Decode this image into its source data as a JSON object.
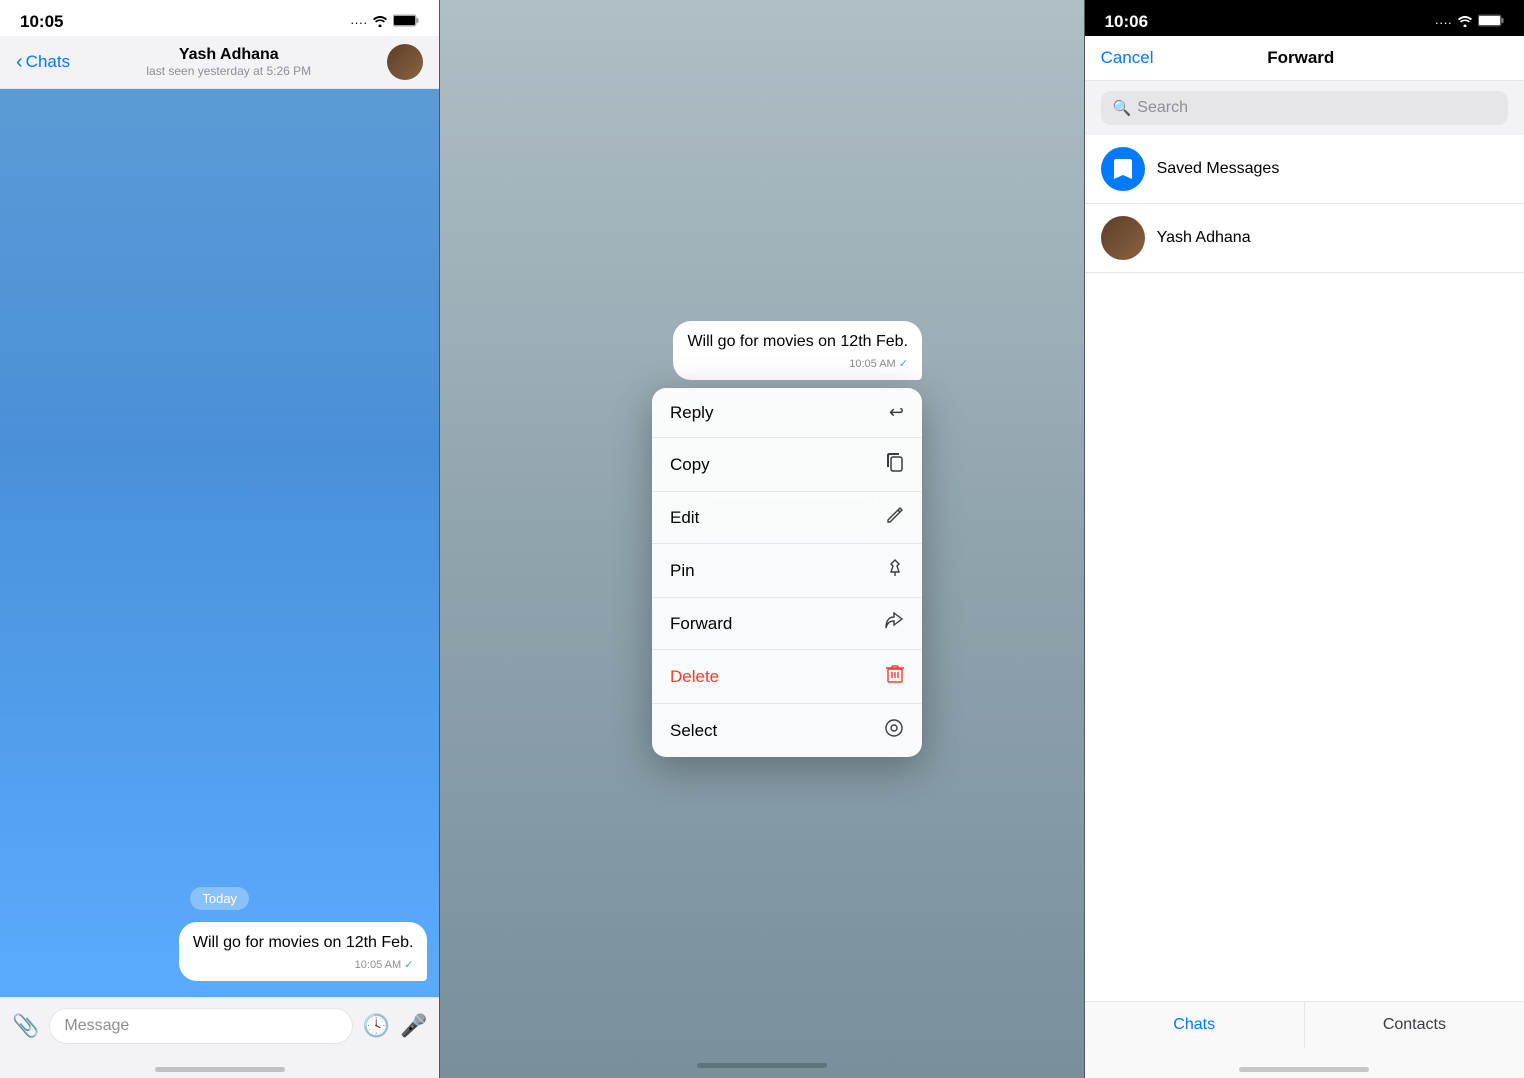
{
  "panel1": {
    "status_bar": {
      "time": "10:05",
      "signal": "···· ",
      "wifi": "WiFi",
      "battery": "🔋"
    },
    "header": {
      "back_label": "Chats",
      "contact_name": "Yash Adhana",
      "contact_status": "last seen yesterday at 5:26 PM"
    },
    "date_badge": "Today",
    "message": {
      "text": "Will go for movies on 12th Feb.",
      "time": "10:05 AM",
      "check": "✓"
    },
    "input": {
      "placeholder": "Message"
    }
  },
  "panel2": {
    "message": {
      "text": "Will go for movies on 12th Feb.",
      "time": "10:05 AM",
      "check": "✓"
    },
    "menu_items": [
      {
        "label": "Reply",
        "icon": "↩",
        "is_delete": false
      },
      {
        "label": "Copy",
        "icon": "⧉",
        "is_delete": false
      },
      {
        "label": "Edit",
        "icon": "✎",
        "is_delete": false
      },
      {
        "label": "Pin",
        "icon": "⚲",
        "is_delete": false
      },
      {
        "label": "Forward",
        "icon": "↪",
        "is_delete": false
      },
      {
        "label": "Delete",
        "icon": "🗑",
        "is_delete": true
      },
      {
        "label": "Select",
        "icon": "⊙",
        "is_delete": false
      }
    ]
  },
  "panel3": {
    "status_bar": {
      "time": "10:06",
      "signal": "···· ",
      "wifi": "WiFi",
      "battery": "🔋"
    },
    "header": {
      "cancel_label": "Cancel",
      "title": "Forward"
    },
    "search": {
      "placeholder": "Search"
    },
    "contacts": [
      {
        "name": "Saved Messages",
        "type": "saved"
      },
      {
        "name": "Yash Adhana",
        "type": "user"
      }
    ],
    "tabs": [
      {
        "label": "Chats",
        "active": true
      },
      {
        "label": "Contacts",
        "active": false
      }
    ]
  }
}
